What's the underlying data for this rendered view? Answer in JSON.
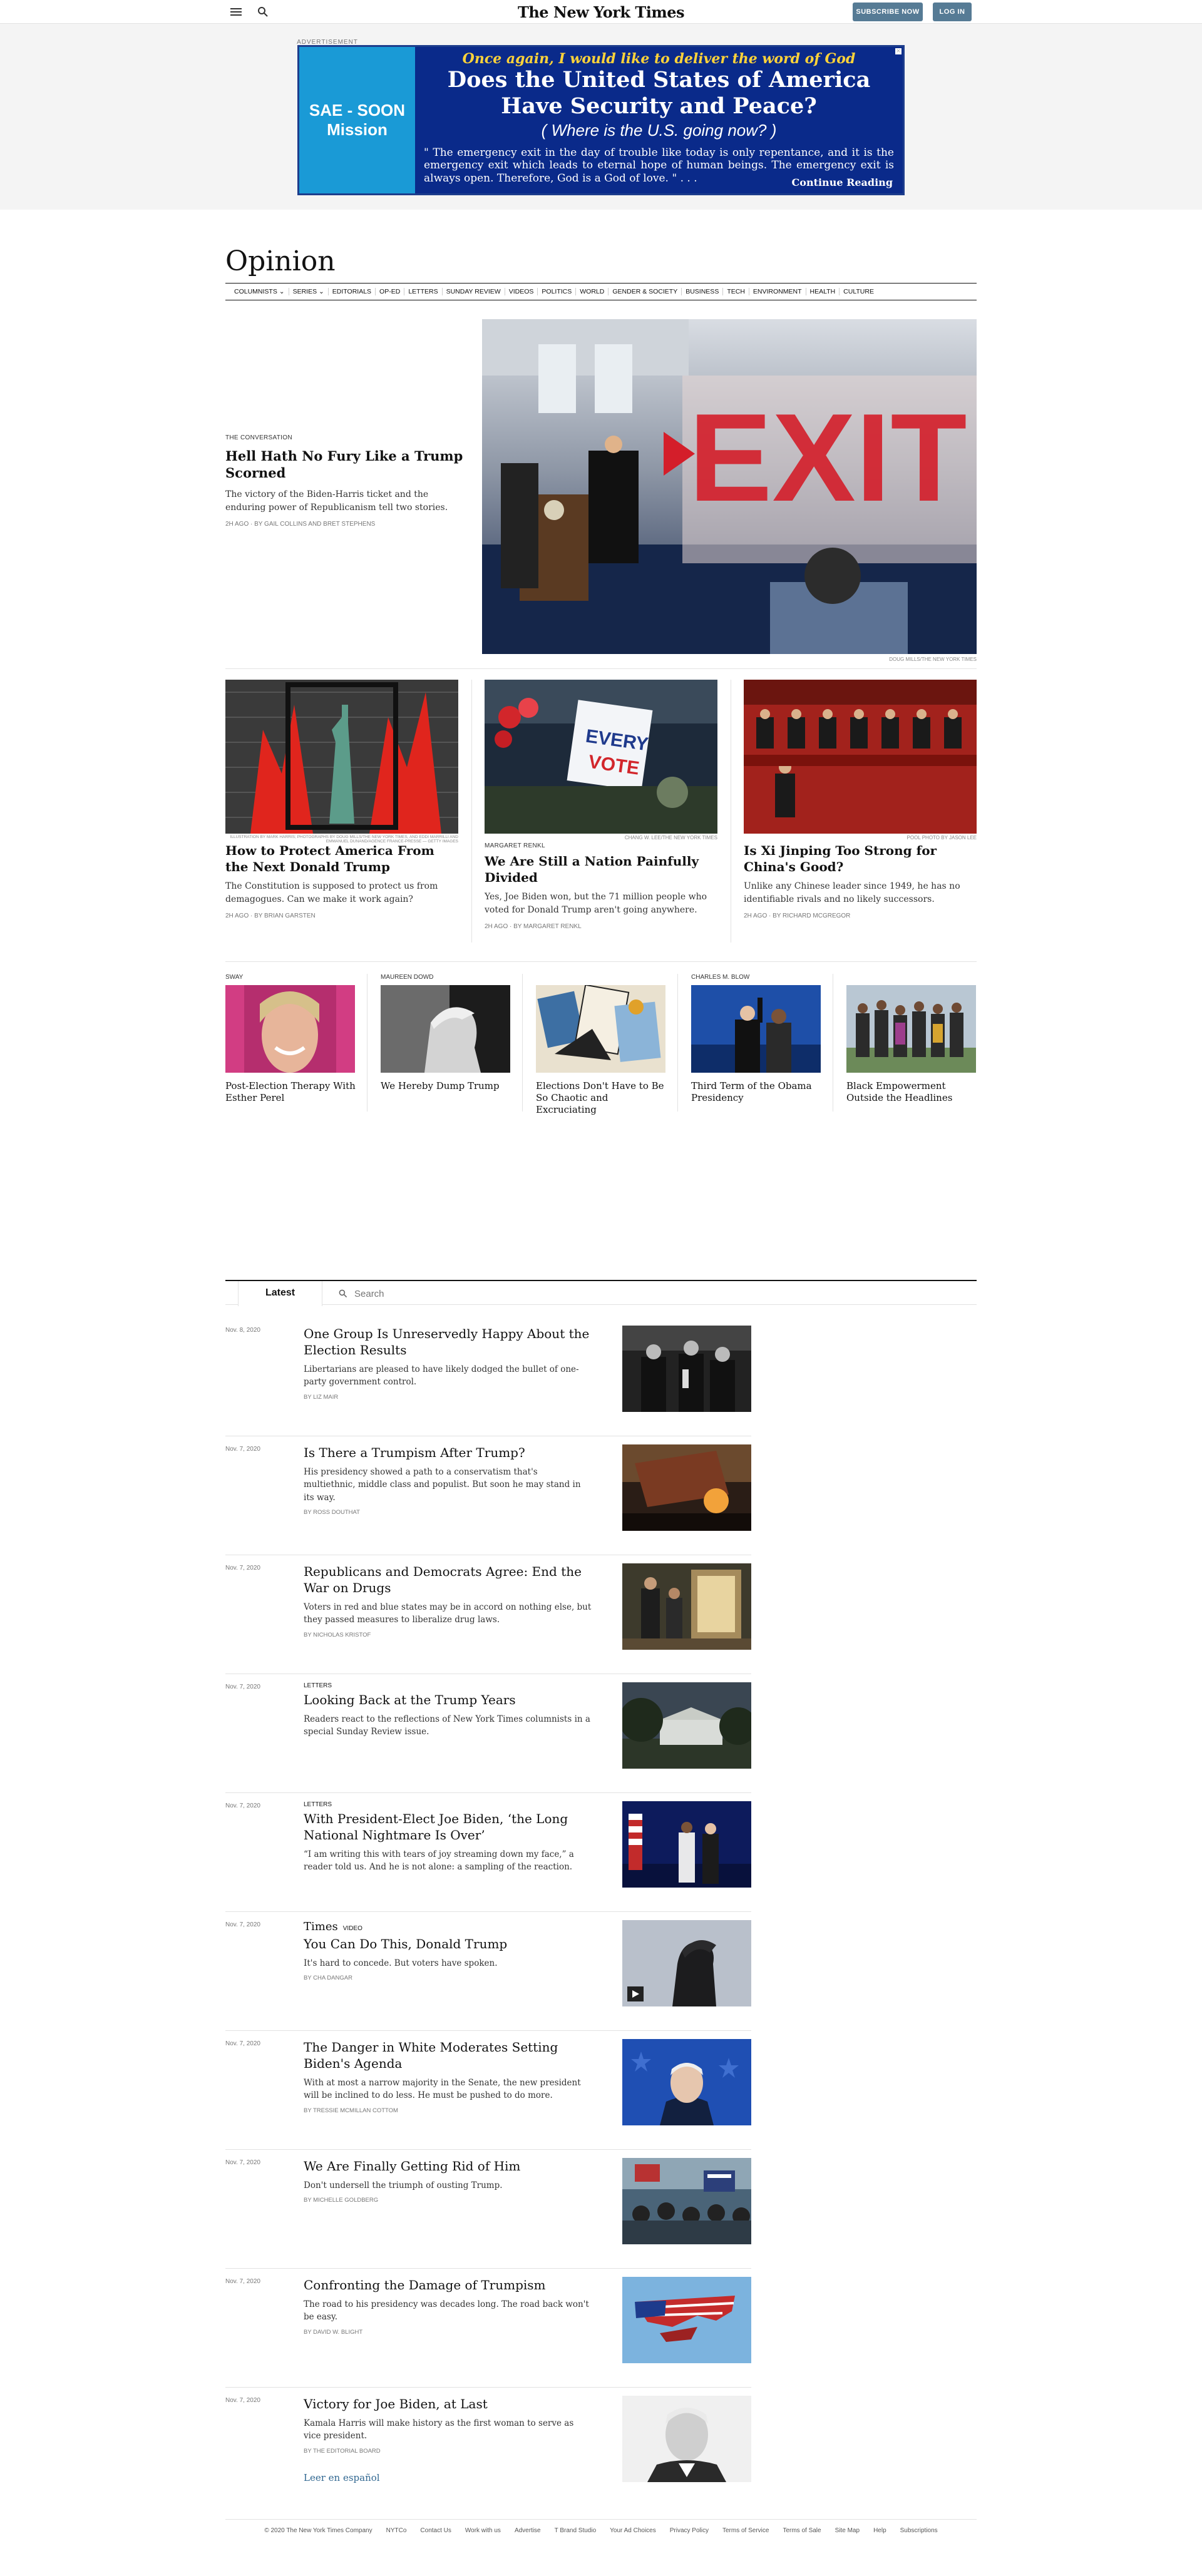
{
  "masthead": {
    "logo": "The New York Times",
    "subscribe_label": "SUBSCRIBE NOW",
    "login_label": "LOG IN"
  },
  "ad": {
    "label": "ADVERTISEMENT",
    "left_text": "SAE - SOON Mission",
    "top_line": "Once again, I would like to deliver the word of God",
    "headline": "Does the United States of America Have Security and Peace?",
    "subhead": "( Where is the U.S. going now? )",
    "body": "\" The emergency exit in the day of trouble like today is only repentance, and it is the emergency exit which leads to eternal hope of human beings. The emergency exit is always open. Therefore, God is a God of love. \" . . .",
    "cta": "Continue Reading",
    "bg_color": "#0a2a8a",
    "left_color": "#1a9ad6"
  },
  "section": {
    "title": "Opinion",
    "nav": [
      "COLUMNISTS ⌄",
      "SERIES ⌄",
      "EDITORIALS",
      "OP-ED",
      "LETTERS",
      "SUNDAY REVIEW",
      "VIDEOS",
      "POLITICS",
      "WORLD",
      "GENDER & SOCIETY",
      "BUSINESS",
      "TECH",
      "ENVIRONMENT",
      "HEALTH",
      "CULTURE"
    ]
  },
  "hero": {
    "kicker": "THE CONVERSATION",
    "title": "Hell Hath No Fury Like a Trump Scorned",
    "summary": "The victory of the Biden-Harris ticket and the enduring power of Republicanism tell two stories.",
    "byline": "2h ago · By GAIL COLLINS and BRET STEPHENS",
    "credit": "DOUG MILLS/THE NEW YORK TIMES",
    "image_icon": "exit-sign-press-room-photo"
  },
  "cards": [
    {
      "kicker": "",
      "title": "How to Protect America From the Next Donald Trump",
      "summary": "The Constitution is supposed to protect us from demagogues. Can we make it work again?",
      "byline": "2h ago · By BRIAN GARSTEN",
      "credit": "ILLUSTRATION BY MARK HARRIS; PHOTOGRAPHS BY DOUG MILLS/THE NEW YORK TIMES, AND EDDI MARRILLI AND EMMANUEL DUNAND/AGENCE FRANCE-PRESSE — GETTY IMAGES",
      "image_icon": "statue-of-liberty-illustration"
    },
    {
      "kicker": "MARGARET RENKL",
      "title": "We Are Still a Nation Painfully Divided",
      "summary": "Yes, Joe Biden won, but the 71 million people who voted for Donald Trump aren't going anywhere.",
      "byline": "2h ago · By MARGARET RENKL",
      "credit": "CHANG W. LEE/THE NEW YORK TIMES",
      "image_icon": "every-vote-rally-photo"
    },
    {
      "kicker": "",
      "title": "Is Xi Jinping Too Strong for China's Good?",
      "summary": "Unlike any Chinese leader since 1949, he has no identifiable rivals and no likely successors.",
      "byline": "2h ago · By RICHARD MCGREGOR",
      "credit": "POOL PHOTO BY JASON LEE",
      "image_icon": "chinese-leadership-photo"
    }
  ],
  "five": [
    {
      "kicker": "SWAY",
      "title": "Post-Election Therapy With Esther Perel",
      "image_icon": "esther-perel-portrait"
    },
    {
      "kicker": "MAUREEN DOWD",
      "title": "We Hereby Dump Trump",
      "image_icon": "trump-profile-photo"
    },
    {
      "kicker": "",
      "title": "Elections Don't Have to Be So Chaotic and Excruciating",
      "image_icon": "ballot-illustration"
    },
    {
      "kicker": "CHARLES M. BLOW",
      "title": "Third Term of the Obama Presidency",
      "image_icon": "biden-obama-stage-photo"
    },
    {
      "kicker": "",
      "title": "Black Empowerment Outside the Headlines",
      "image_icon": "group-portrait-photo"
    }
  ],
  "latest": {
    "tab": "Latest",
    "search_placeholder": "Search",
    "stories": [
      {
        "date": "Nov. 8, 2020",
        "kicker": "",
        "title": "One Group Is Unreservedly Happy About the Election Results",
        "summary": "Libertarians are pleased to have likely dodged the bullet of one-party government control.",
        "byline": "By LIZ MAIR",
        "image_icon": "capitol-press-bw-photo"
      },
      {
        "date": "Nov. 7, 2020",
        "kicker": "",
        "title": "Is There a Trumpism After Trump?",
        "summary": "His presidency showed a path to a conservatism that's multiethnic, middle class and populist. But soon he may stand in its way.",
        "byline": "By ROSS DOUTHAT",
        "image_icon": "flag-at-dusk-photo"
      },
      {
        "date": "Nov. 7, 2020",
        "kicker": "",
        "title": "Republicans and Democrats Agree: End the War on Drugs",
        "summary": "Voters in red and blue states may be in accord on nothing else, but they passed measures to liberalize drug laws.",
        "byline": "By NICHOLAS KRISTOF",
        "image_icon": "police-raid-photo"
      },
      {
        "date": "Nov. 7, 2020",
        "kicker": "LETTERS",
        "title": "Looking Back at the Trump Years",
        "summary": "Readers react to the reflections of New York Times columnists in a special Sunday Review issue.",
        "byline": "",
        "image_icon": "white-house-photo"
      },
      {
        "date": "Nov. 7, 2020",
        "kicker": "LETTERS",
        "title": "With President-Elect Joe Biden, ‘the Long National Nightmare Is Over’",
        "summary": "“I am writing this with tears of joy streaming down my face,” a reader told us. And he is not alone: a sampling of the reaction.",
        "byline": "",
        "image_icon": "biden-harris-stage-photo"
      },
      {
        "date": "Nov. 7, 2020",
        "kicker": "VIDEO",
        "brand": "Times",
        "title": "You Can Do This, Donald Trump",
        "summary": "It's hard to concede. But voters have spoken.",
        "byline": "By CHA DANGAR",
        "image_icon": "trump-silhouette-video"
      },
      {
        "date": "Nov. 7, 2020",
        "kicker": "",
        "title": "The Danger in White Moderates Setting Biden's Agenda",
        "summary": "With at most a narrow majority in the Senate, the new president will be inclined to do less. He must be pushed to do more.",
        "byline": "By TRESSIE MCMILLAN COTTOM",
        "image_icon": "biden-blue-background-photo"
      },
      {
        "date": "Nov. 7, 2020",
        "kicker": "",
        "title": "We Are Finally Getting Rid of Him",
        "summary": "Don't undersell the triumph of ousting Trump.",
        "byline": "By MICHELLE GOLDBERG",
        "image_icon": "celebration-crowd-photo"
      },
      {
        "date": "Nov. 7, 2020",
        "kicker": "",
        "title": "Confronting the Damage of Trumpism",
        "summary": "The road to his presidency was decades long. The road back won't be easy.",
        "byline": "By DAVID W. BLIGHT",
        "image_icon": "torn-flag-photo"
      },
      {
        "date": "Nov. 7, 2020",
        "kicker": "",
        "title": "Victory for Joe Biden, at Last",
        "summary": "Kamala Harris will make history as the first woman to serve as vice president.",
        "byline": "By THE EDITORIAL BOARD",
        "image_icon": "biden-bw-portrait"
      }
    ],
    "espanol": "Leer en español"
  },
  "footer": {
    "items": [
      "© 2020 The New York Times Company",
      "NYTCo",
      "Contact Us",
      "Work with us",
      "Advertise",
      "T Brand Studio",
      "Your Ad Choices",
      "Privacy Policy",
      "Terms of Service",
      "Terms of Sale",
      "Site Map",
      "Help",
      "Subscriptions"
    ]
  }
}
